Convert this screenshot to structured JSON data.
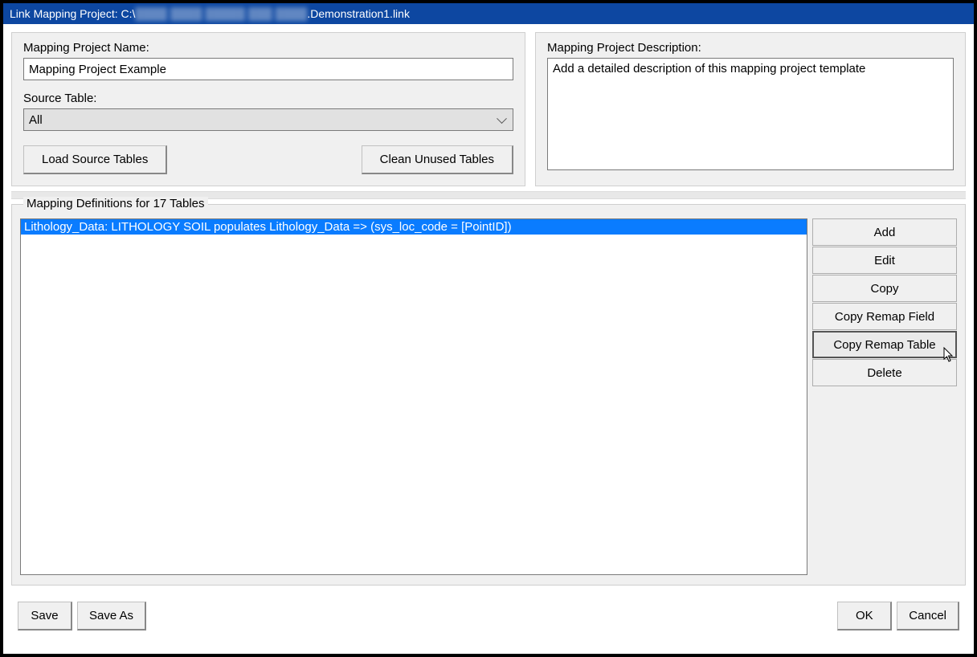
{
  "window": {
    "title_prefix": "Link Mapping Project: C:\\",
    "title_suffix": ".Demonstration1.link"
  },
  "project_name": {
    "label": "Mapping Project Name:",
    "value": "Mapping Project Example"
  },
  "source_table": {
    "label": "Source Table:",
    "selected": "All"
  },
  "buttons": {
    "load_source": "Load Source Tables",
    "clean_unused": "Clean Unused Tables",
    "save": "Save",
    "save_as": "Save As",
    "ok": "OK",
    "cancel": "Cancel"
  },
  "description": {
    "label": "Mapping Project Description:",
    "value": "Add a detailed description of this mapping project template"
  },
  "definitions": {
    "legend": "Mapping Definitions for 17 Tables",
    "items": [
      "Lithology_Data: LITHOLOGY SOIL populates Lithology_Data => (sys_loc_code = [PointID])"
    ],
    "selected_index": 0,
    "actions": {
      "add": "Add",
      "edit": "Edit",
      "copy": "Copy",
      "copy_remap_field": "Copy Remap Field",
      "copy_remap_table": "Copy Remap Table",
      "delete": "Delete"
    }
  }
}
